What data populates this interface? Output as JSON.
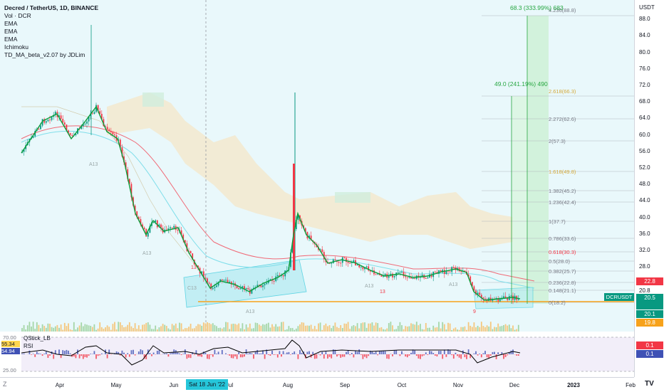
{
  "legend": {
    "title": "Decred / TetherUS, 1D, BINANCE",
    "indicators": [
      "Vol · DCR",
      "EMA",
      "EMA",
      "EMA",
      "Ichimoku",
      "TD_MA_beta_v2.07 by JDLim"
    ]
  },
  "price_scale": {
    "currency": "USDT",
    "ticks": [
      "88.0",
      "84.0",
      "80.0",
      "76.0",
      "72.0",
      "68.0",
      "64.0",
      "60.0",
      "56.0",
      "52.0",
      "48.0",
      "44.0",
      "40.0",
      "36.0",
      "32.0",
      "28.0",
      "24.0",
      "20.8"
    ],
    "badges": [
      {
        "text": "22.8",
        "color": "#f23645"
      },
      {
        "text": "20.5",
        "color": "#089981"
      },
      {
        "text": "20.1",
        "color": "#089981"
      },
      {
        "text": "19.8",
        "color": "#f7a21b"
      }
    ],
    "symbol_tag": "DCRUSDT",
    "symbol_price": "20.5"
  },
  "fib_levels": [
    {
      "label": "4.236(88.8)",
      "color": "#b2b5be"
    },
    {
      "label": "2.618(66.3)",
      "color": "#e9c46a"
    },
    {
      "label": "2.272(62.6)",
      "color": "#787b86"
    },
    {
      "label": "2(57.3)",
      "color": "#787b86"
    },
    {
      "label": "1.618(49.8)",
      "color": "#e9c46a"
    },
    {
      "label": "1.382(45.2)",
      "color": "#787b86"
    },
    {
      "label": "1.236(42.4)",
      "color": "#787b86"
    },
    {
      "label": "1(37.7)",
      "color": "#787b86"
    },
    {
      "label": "0.786(33.6)",
      "color": "#787b86"
    },
    {
      "label": "0.618(30.3)",
      "color": "#f23645"
    },
    {
      "label": "0.5(28.0)",
      "color": "#787b86"
    },
    {
      "label": "0.382(25.7)",
      "color": "#787b86"
    },
    {
      "label": "0.236(22.8)",
      "color": "#787b86"
    },
    {
      "label": "0.148(21.1)",
      "color": "#787b86"
    },
    {
      "label": "0(18.2)",
      "color": "#787b86"
    }
  ],
  "targets": [
    {
      "text": "68.3 (333.99%) 683"
    },
    {
      "text": "49.0 (241.19%) 490"
    }
  ],
  "sub_pane": {
    "qstick_label": "QStick_LB",
    "rsi_label": "RSI",
    "left_values": [
      "70.00",
      "55.34",
      "54.94",
      "25.00"
    ],
    "right_values": [
      {
        "text": "0.1",
        "color": "#f23645"
      },
      {
        "text": "0.1",
        "color": "#3f51b5"
      }
    ]
  },
  "time_axis": {
    "labels": [
      "Apr",
      "May",
      "Jun",
      "Jul",
      "Aug",
      "Sep",
      "Oct",
      "Nov",
      "Dec",
      "2023",
      "Feb"
    ],
    "crosshair_label": "Sat 18 Jun '22"
  },
  "corner_icons": [
    "zoom-icon",
    "tradingview-logo"
  ],
  "colors": {
    "up": "#089981",
    "down": "#f23645",
    "ema_red": "#f06a77",
    "ema_blue": "#80deea",
    "cloud": "#f5e6c4",
    "channel": "#b2ebf2",
    "target_box": "#c8f0cf",
    "support": "#f7a21b"
  },
  "chart_data": {
    "type": "candlestick",
    "title": "Decred / TetherUS, 1D, BINANCE",
    "x": [
      "Apr",
      "May",
      "Jun",
      "Jul",
      "Aug",
      "Sep",
      "Oct",
      "Nov",
      "Dec"
    ],
    "close_approx": [
      62,
      45,
      30,
      24,
      24,
      26,
      25,
      25,
      19,
      20
    ],
    "ylim": [
      16,
      92
    ]
  }
}
